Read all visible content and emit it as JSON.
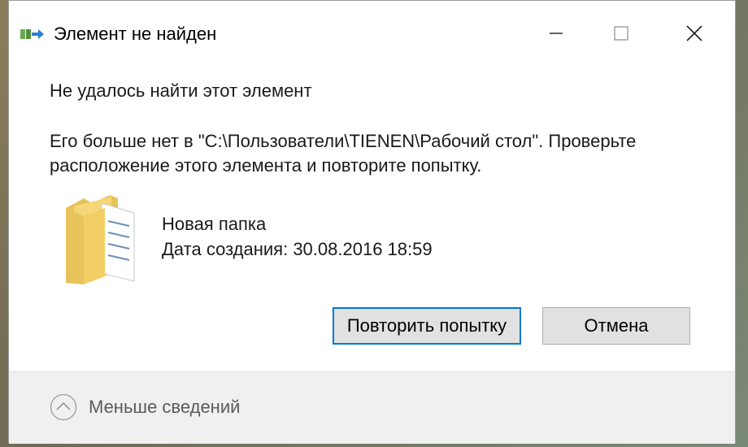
{
  "window": {
    "title": "Элемент не найден"
  },
  "content": {
    "heading": "Не удалось найти этот элемент",
    "message": "Его больше нет в \"C:\\Пользователи\\TIENEN\\Рабочий стол\". Проверьте расположение этого элемента и повторите попытку.",
    "item_name": "Новая папка",
    "item_date": "Дата создания: 30.08.2016 18:59"
  },
  "buttons": {
    "retry_label": "Повторить попытку",
    "cancel_label": "Отмена"
  },
  "footer": {
    "toggle_label": "Меньше сведений"
  },
  "icons": {
    "app": "moved-file-icon",
    "minimize": "minimize-icon",
    "maximize": "maximize-icon",
    "close": "close-icon",
    "folder": "folder-icon",
    "chevron": "chevron-up-icon"
  }
}
